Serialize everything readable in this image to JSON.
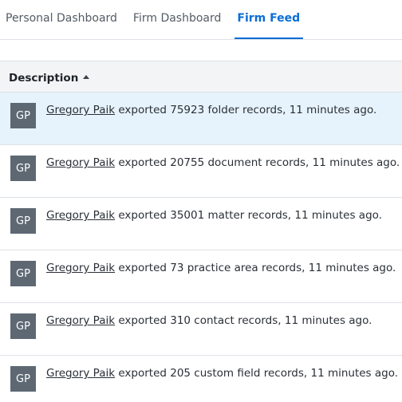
{
  "tabs": [
    {
      "label": "Personal Dashboard",
      "active": false
    },
    {
      "label": "Firm Dashboard",
      "active": false
    },
    {
      "label": "Firm Feed",
      "active": true
    }
  ],
  "colors": {
    "accent": "#0a6dd6",
    "avatar_bg": "#5d6873",
    "selected_row_bg": "#e7f3fc",
    "header_bg": "#f3f4f6"
  },
  "table": {
    "header": {
      "label": "Description",
      "sort_icon": "sort-ascending-icon"
    },
    "rows": [
      {
        "initials": "GP",
        "user": "Gregory Paik",
        "text": " exported 75923 folder records, 11 minutes ago.",
        "selected": true
      },
      {
        "initials": "GP",
        "user": "Gregory Paik",
        "text": " exported 20755 document records, 11 minutes ago.",
        "selected": false
      },
      {
        "initials": "GP",
        "user": "Gregory Paik",
        "text": " exported 35001 matter records, 11 minutes ago.",
        "selected": false
      },
      {
        "initials": "GP",
        "user": "Gregory Paik",
        "text": " exported 73 practice area records, 11 minutes ago.",
        "selected": false
      },
      {
        "initials": "GP",
        "user": "Gregory Paik",
        "text": " exported 310 contact records, 11 minutes ago.",
        "selected": false
      },
      {
        "initials": "GP",
        "user": "Gregory Paik",
        "text": " exported 205 custom field records, 11 minutes ago.",
        "selected": false
      }
    ]
  }
}
